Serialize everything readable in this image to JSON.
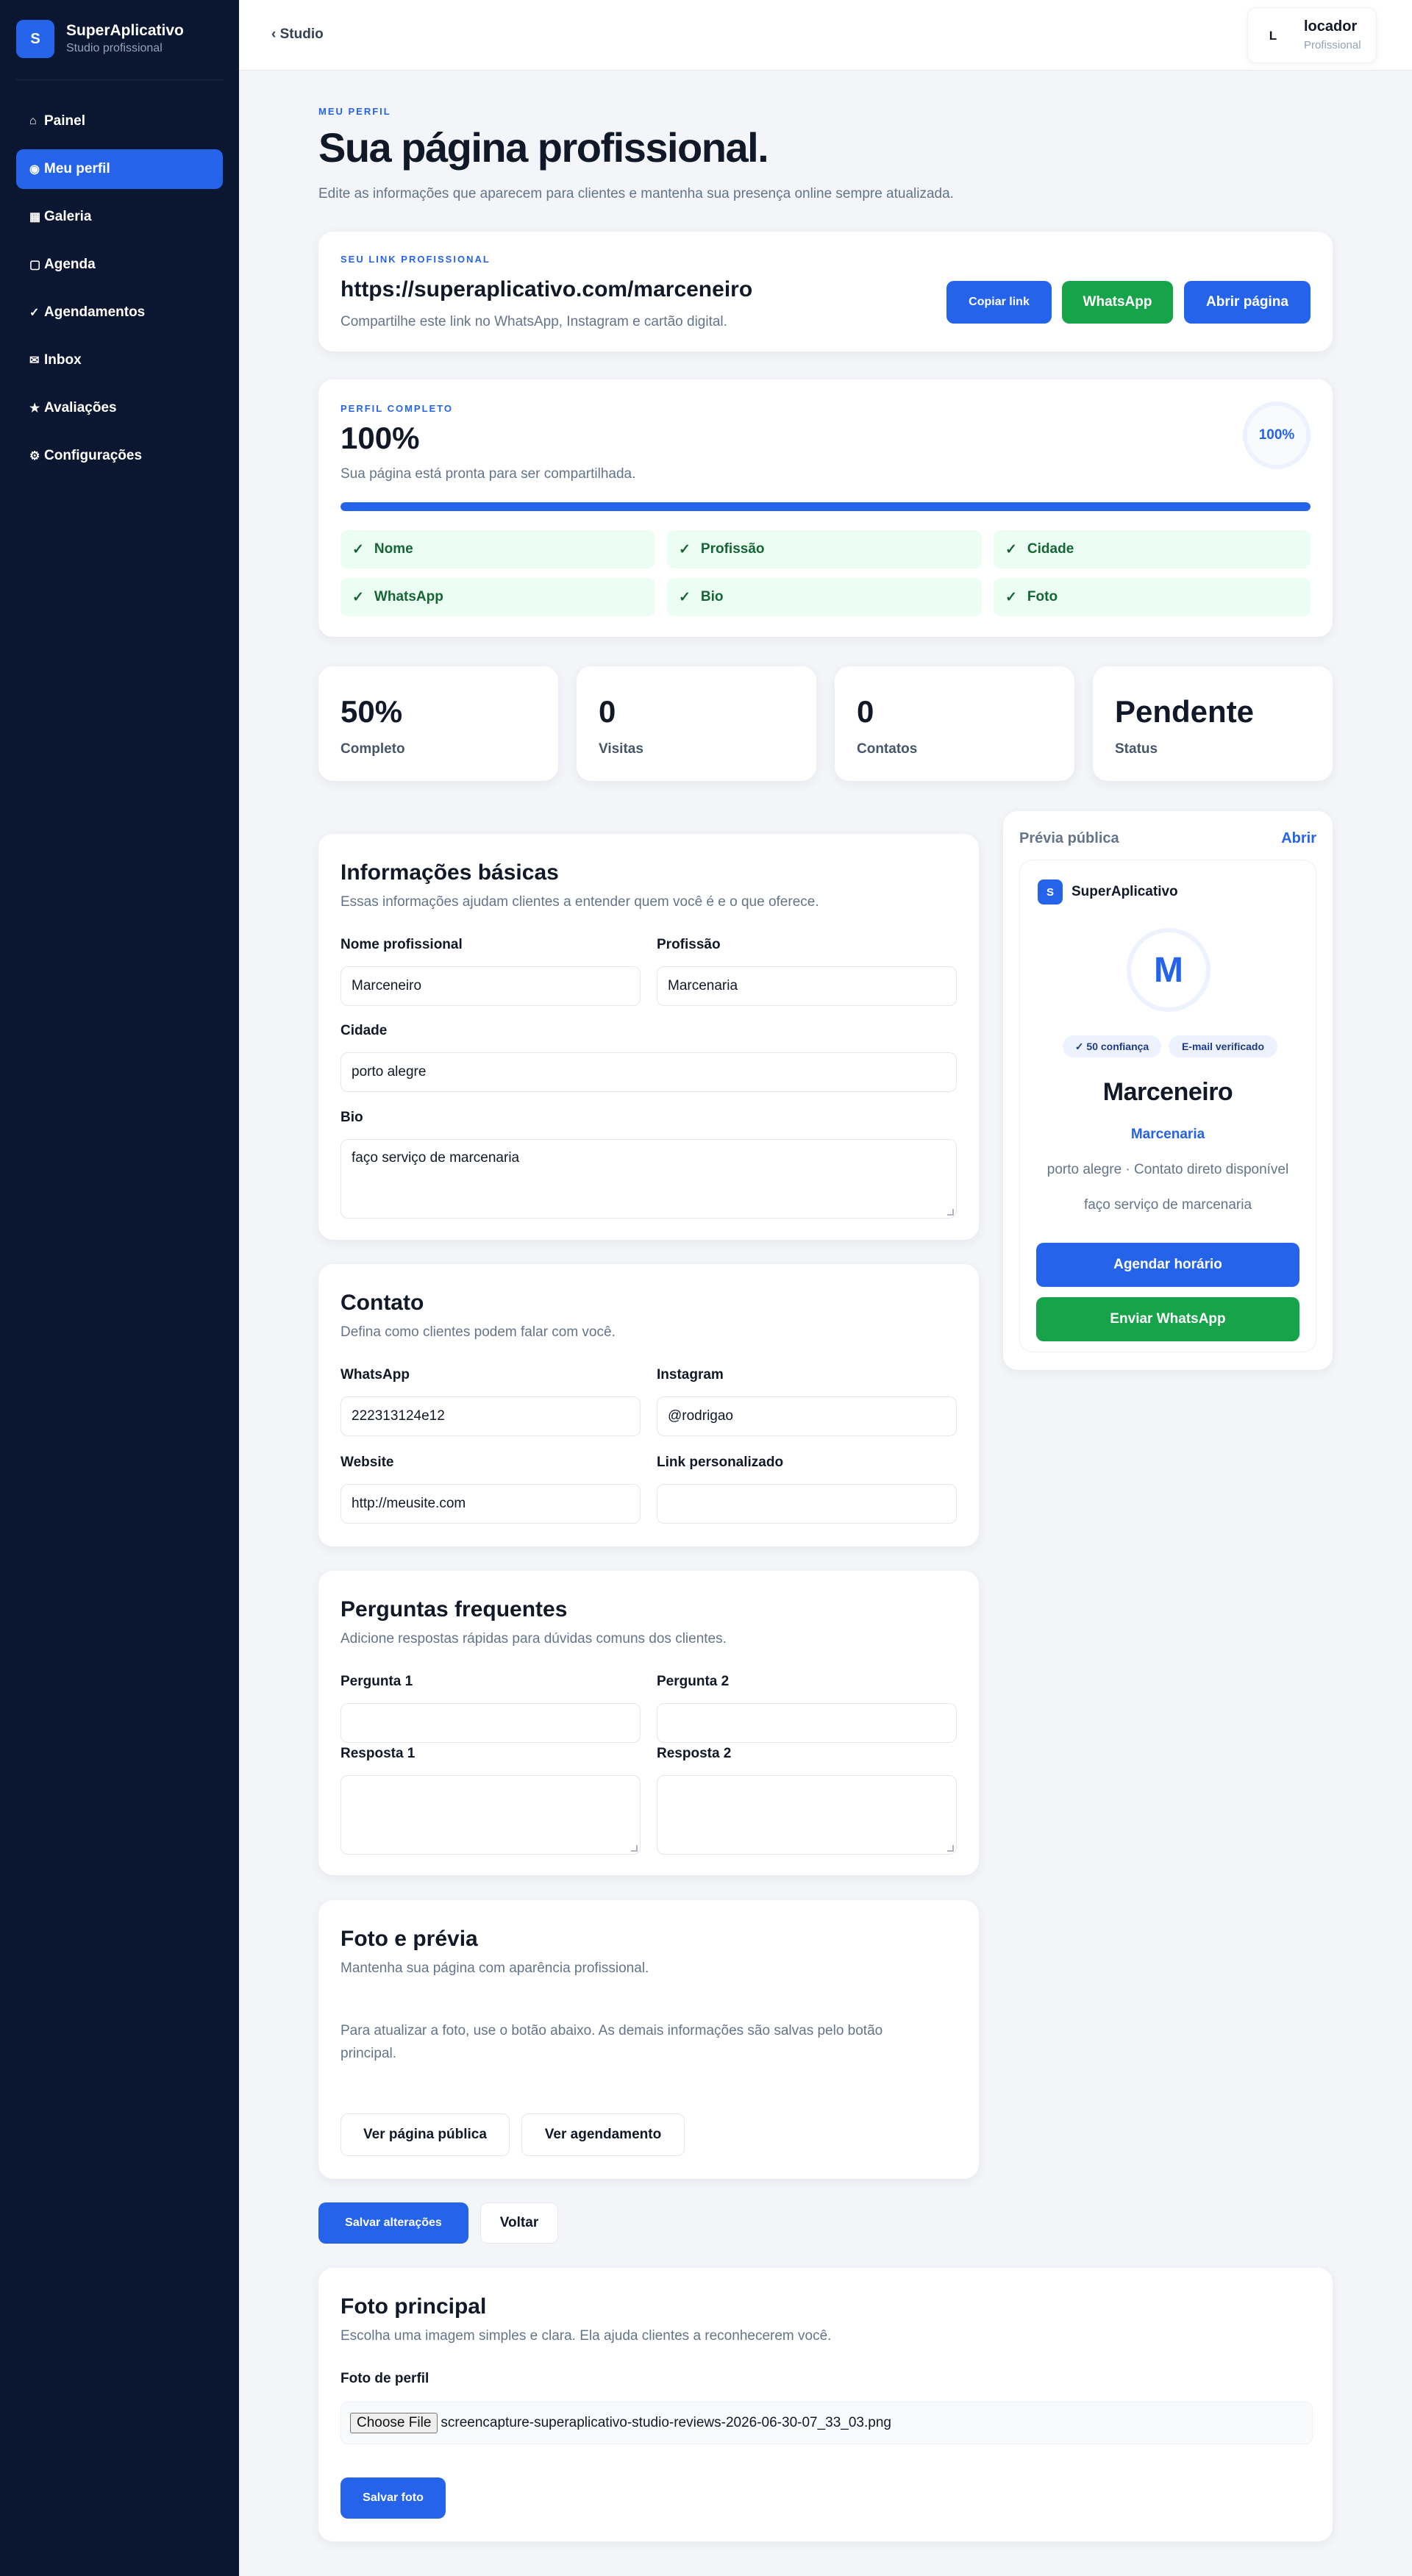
{
  "brand": {
    "logo_letter": "S",
    "name": "SuperAplicativo",
    "subtitle": "Studio profissional"
  },
  "nav": [
    {
      "icon": "⌂",
      "icon_name": "home-icon",
      "label": "Painel"
    },
    {
      "icon": "◉",
      "icon_name": "profile-icon",
      "label": "Meu perfil",
      "active": true
    },
    {
      "icon": "▦",
      "icon_name": "gallery-icon",
      "label": "Galeria"
    },
    {
      "icon": "▢",
      "icon_name": "calendar-icon",
      "label": "Agenda"
    },
    {
      "icon": "✓",
      "icon_name": "check-icon",
      "label": "Agendamentos"
    },
    {
      "icon": "✉",
      "icon_name": "inbox-icon",
      "label": "Inbox"
    },
    {
      "icon": "★",
      "icon_name": "star-icon",
      "label": "Avaliações"
    },
    {
      "icon": "⚙",
      "icon_name": "gear-icon",
      "label": "Configurações"
    }
  ],
  "topbar": {
    "back_label": "‹ Studio",
    "user": {
      "initial": "L",
      "name": "locador",
      "role": "Profissional"
    }
  },
  "page": {
    "eyebrow": "MEU PERFIL",
    "title": "Sua página profissional.",
    "subtitle": "Edite as informações que aparecem para clientes e mantenha sua presença online sempre atualizada."
  },
  "link_card": {
    "eyebrow": "SEU LINK PROFISSIONAL",
    "url": "https://superaplicativo.com/marceneiro",
    "subtitle": "Compartilhe este link no WhatsApp, Instagram e cartão digital.",
    "copy_label": "Copiar link",
    "whatsapp_label": "WhatsApp",
    "open_label": "Abrir página"
  },
  "completeness": {
    "eyebrow": "PERFIL COMPLETO",
    "percent_label": "100%",
    "percent_value": 100,
    "subtitle": "Sua página está pronta para ser compartilhada.",
    "ring_label": "100%",
    "checks": [
      "Nome",
      "Profissão",
      "Cidade",
      "WhatsApp",
      "Bio",
      "Foto"
    ]
  },
  "stats": [
    {
      "value": "50%",
      "label": "Completo"
    },
    {
      "value": "0",
      "label": "Visitas"
    },
    {
      "value": "0",
      "label": "Contatos"
    },
    {
      "value": "Pendente",
      "label": "Status"
    }
  ],
  "basic_info": {
    "title": "Informações básicas",
    "subtitle": "Essas informações ajudam clientes a entender quem você é e o que oferece.",
    "name_label": "Nome profissional",
    "name_value": "Marceneiro",
    "profession_label": "Profissão",
    "profession_value": "Marcenaria",
    "city_label": "Cidade",
    "city_value": "porto alegre",
    "bio_label": "Bio",
    "bio_value": "faço serviço de marcenaria"
  },
  "contact": {
    "title": "Contato",
    "subtitle": "Defina como clientes podem falar com você.",
    "whatsapp_label": "WhatsApp",
    "whatsapp_value": "222313124e12",
    "instagram_label": "Instagram",
    "instagram_value": "@rodrigao",
    "website_label": "Website",
    "website_value": "http://meusite.com",
    "custom_link_label": "Link personalizado",
    "custom_link_value": ""
  },
  "faq": {
    "title": "Perguntas frequentes",
    "subtitle": "Adicione respostas rápidas para dúvidas comuns dos clientes.",
    "q1_label": "Pergunta 1",
    "q2_label": "Pergunta 2",
    "a1_label": "Resposta 1",
    "a2_label": "Resposta 2"
  },
  "photo_preview": {
    "title": "Foto e prévia",
    "subtitle": "Mantenha sua página com aparência profissional.",
    "note": "Para atualizar a foto, use o botão abaixo. As demais informações são salvas pelo botão principal.",
    "public_page_label": "Ver página pública",
    "booking_label": "Ver agendamento"
  },
  "actions": {
    "save_label": "Salvar alterações",
    "back_label": "Voltar"
  },
  "main_photo": {
    "title": "Foto principal",
    "subtitle": "Escolha uma imagem simples e clara. Ela ajuda clientes a reconhecerem você.",
    "field_label": "Foto de perfil",
    "choose_label": "Choose File",
    "file_name": "screencapture-superaplicativo-studio-reviews-2026-06-30-07_33_03.png",
    "save_label": "Salvar foto"
  },
  "preview": {
    "heading": "Prévia pública",
    "open_label": "Abrir",
    "brand_letter": "S",
    "brand_name": "SuperAplicativo",
    "avatar_letter": "M",
    "badge_trust": "✓ 50 confiança",
    "badge_email": "E-mail verificado",
    "name": "Marceneiro",
    "profession": "Marcenaria",
    "location": "porto alegre · Contato direto disponível",
    "bio": "faço serviço de marcenaria",
    "book_label": "Agendar horário",
    "whatsapp_label": "Enviar WhatsApp"
  },
  "colors": {
    "accent": "#2563eb",
    "success": "#16a34a",
    "sidebar": "#0b1630",
    "check_bg": "#ecfdf3"
  }
}
